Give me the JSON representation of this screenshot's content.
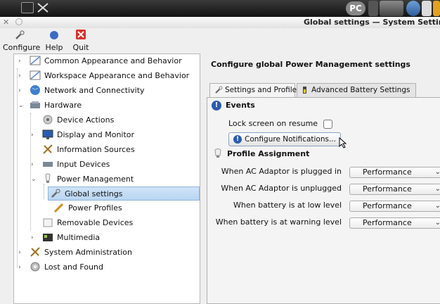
{
  "window": {
    "title": "Global settings — System Settings"
  },
  "taskbar": {
    "tray_label": "PC"
  },
  "toolbar": {
    "configure_label": "Configure",
    "help_label": "Help",
    "quit_label": "Quit"
  },
  "tree": [
    {
      "label": "Common Appearance and Behavior",
      "icon": "appearance-icon"
    },
    {
      "label": "Workspace Appearance and Behavior",
      "icon": "workspace-icon"
    },
    {
      "label": "Network and Connectivity",
      "icon": "network-icon"
    },
    {
      "label": "Hardware",
      "icon": "hardware-icon"
    },
    {
      "label": "Device Actions",
      "icon": "device-actions-icon"
    },
    {
      "label": "Display and Monitor",
      "icon": "display-icon"
    },
    {
      "label": "Information Sources",
      "icon": "information-icon"
    },
    {
      "label": "Input Devices",
      "icon": "input-devices-icon"
    },
    {
      "label": "Power Management",
      "icon": "power-icon"
    },
    {
      "label": "Global settings",
      "icon": "global-settings-icon"
    },
    {
      "label": "Power Profiles",
      "icon": "power-profiles-icon"
    },
    {
      "label": "Removable Devices",
      "icon": "removable-devices-icon"
    },
    {
      "label": "Multimedia",
      "icon": "multimedia-icon"
    },
    {
      "label": "System Administration",
      "icon": "system-admin-icon"
    },
    {
      "label": "Lost and Found",
      "icon": "lost-found-icon"
    }
  ],
  "main": {
    "heading": "Configure global Power Management settings",
    "tabs": [
      {
        "label": "Settings and Profile"
      },
      {
        "label": "Advanced Battery Settings"
      }
    ],
    "events": {
      "title": "Events",
      "lock_screen_label": "Lock screen on resume",
      "configure_notifications_label": "Configure Notifications..."
    },
    "profile": {
      "title": "Profile Assignment",
      "rows": [
        {
          "label": "When AC Adaptor is plugged in",
          "value": "Performance"
        },
        {
          "label": "When AC Adaptor is unplugged",
          "value": "Performance"
        },
        {
          "label": "When battery is at low level",
          "value": "Performance"
        },
        {
          "label": "When battery is at warning level",
          "value": "Performance"
        }
      ]
    }
  },
  "colors": {
    "selection": "#b9d6f2",
    "info_blue": "#2a5db0"
  }
}
